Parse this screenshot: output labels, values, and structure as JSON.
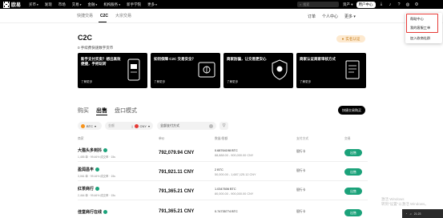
{
  "topnav": {
    "brand": "欧易",
    "items": [
      "买币",
      "发现",
      "市场",
      "交易",
      "金融",
      "机构服务",
      "新手学院",
      "更多"
    ],
    "search_placeholder": "搜索",
    "right": {
      "assets": "资产",
      "user": "用户中心",
      "lang": "中文"
    }
  },
  "subnav": {
    "tabs": [
      "快捷交易",
      "C2C",
      "大宗交易"
    ],
    "active": "C2C",
    "right": [
      "订单",
      "个人中心",
      "更多"
    ]
  },
  "dropdown": {
    "options": [
      "帮助中心",
      "我的客服工单",
      "加入收商社群"
    ]
  },
  "hero": {
    "title": "C2C",
    "subtitle": "0 手续费快速数字货币",
    "badge": "实名认证"
  },
  "cards": [
    {
      "title": "新手支付买卖？想出高效便捷，手把玩转",
      "more": "了解更多"
    },
    {
      "title": "如何保障 C2C 交易安全？",
      "more": "了解更多"
    },
    {
      "title": "商家防骗，让交易更安心",
      "more": "了解更多"
    },
    {
      "title": "商家认证商家审核方式",
      "more": "了解更多"
    }
  ],
  "tabs": {
    "buy": "购买",
    "sell": "出售",
    "block": "盘口模式",
    "quick_trade": "快捷交易购买"
  },
  "filters": {
    "coin": "BTC",
    "amount_placeholder": "金额",
    "fiat": "CNY",
    "payment": "全部支付方式"
  },
  "table": {
    "headers": [
      "商家",
      "单价",
      "数量/限额",
      "支付方式",
      "交易"
    ],
    "rows": [
      {
        "name": "大猫头多到抖",
        "stats": "1,455 单 · 99.46% 成交率 · 15s",
        "price": "792,079.94 CNY",
        "amount": "0.68764198 BTC",
        "limit": "88,888.00 - 900,000.00 CNY",
        "pay": "银行卡",
        "action": "出售"
      },
      {
        "name": "盈润昌丰",
        "stats": "3,061 单 · 99.16% 成交率 · 15s",
        "price": "791,921.11 CNY",
        "amount": "2 BTC",
        "limit": "50,000.00 - 1,687,125.12 CNY",
        "pay": "银行卡",
        "action": "出售"
      },
      {
        "name": "红茶商行",
        "stats": "2,464 单 · 99.46% 成交率 · 15s",
        "price": "791,365.21 CNY",
        "amount": "1.0347606 BTC",
        "limit": "80,000.00 - 900,000.00 CNY",
        "pay": "银行卡",
        "action": "出售"
      },
      {
        "name": "佳堂商行在线",
        "stats": "",
        "price": "791,365.21 CNY",
        "amount": "0.74735774 BTC",
        "limit": "",
        "pay": "银行卡",
        "action": "出售"
      }
    ]
  },
  "watermark": {
    "line1": "激活 Windows",
    "line2": "转到\"设置\"以激活 Windows。"
  },
  "taskbar": {
    "time": "21:23"
  },
  "colors": {
    "accent_green": "#1ba27a",
    "highlight_red": "#e53935",
    "badge_bg": "#fde9cf"
  }
}
